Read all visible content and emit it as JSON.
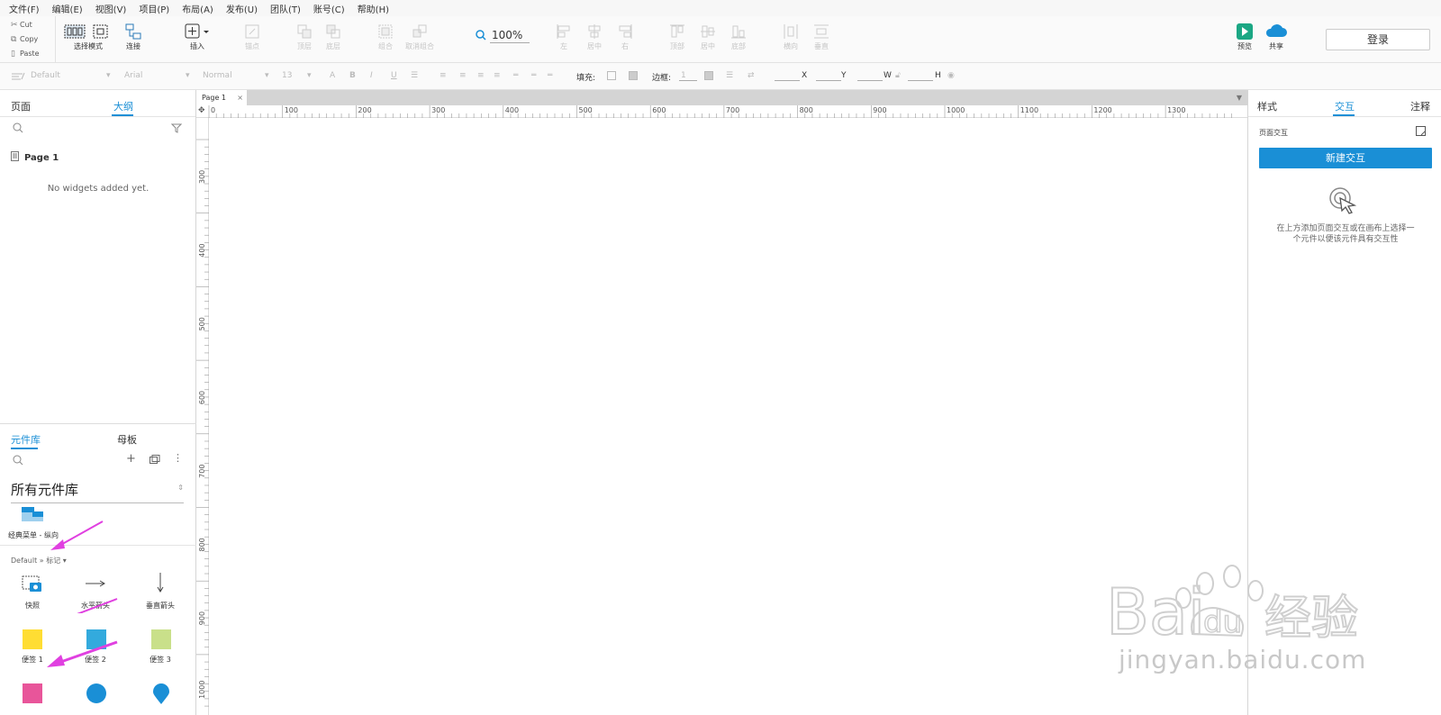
{
  "menu": [
    "文件(F)",
    "编辑(E)",
    "视图(V)",
    "项目(P)",
    "布局(A)",
    "发布(U)",
    "团队(T)",
    "账号(C)",
    "帮助(H)"
  ],
  "clipboard": {
    "cut": "Cut",
    "copy": "Copy",
    "paste": "Paste"
  },
  "toolbar": {
    "select_mode": "选择模式",
    "connect": "连接",
    "insert": "插入",
    "point": "锚点",
    "top": "顶层",
    "bottom": "底层",
    "group": "组合",
    "ungroup": "取消组合",
    "zoom": "100%",
    "left": "左",
    "hcenter": "居中",
    "right": "右",
    "top_align": "顶部",
    "vcenter": "居中",
    "bottom_align": "底部",
    "horizontal": "横向",
    "vertical": "垂直",
    "preview": "预览",
    "share": "共享",
    "login": "登录"
  },
  "stylebar": {
    "style": "Default",
    "font": "Arial",
    "weight": "Normal",
    "size": "13",
    "fill": "填充:",
    "border": "边框:",
    "border_value": "1",
    "x": "X",
    "y": "Y",
    "w": "W",
    "h": "H"
  },
  "left_panel": {
    "tab_pages": "页面",
    "tab_outline": "大纲",
    "page_item": "Page 1",
    "empty": "No widgets added yet.",
    "tab_library": "元件库",
    "tab_masters": "母板",
    "library_select": "所有元件库",
    "menu_widget": "经典菜单 - 纵向",
    "section": "Default » 标记 ▾",
    "widgets": [
      "快照",
      "水平箭头",
      "垂直箭头",
      "便签 1",
      "便签 2",
      "便签 3"
    ]
  },
  "canvas": {
    "tab": "Page 1",
    "hticks": [
      "0",
      "100",
      "200",
      "300",
      "400",
      "500",
      "600",
      "700",
      "800",
      "900",
      "1000",
      "1100",
      "1200",
      "1300"
    ],
    "vticks": [
      "300",
      "400",
      "500",
      "600",
      "700",
      "800",
      "900",
      "1000"
    ]
  },
  "right_panel": {
    "tab_style": "样式",
    "tab_interact": "交互",
    "tab_notes": "注释",
    "page_interact": "页面交互",
    "new_interaction": "新建交互",
    "hint": "在上方添加页面交互或在画布上选择一个元件以便该元件具有交互性"
  },
  "watermark": {
    "url": "jingyan.baidu.com"
  },
  "colors": {
    "accent": "#1a8fd6",
    "preview": "#1ba784",
    "arrow": "#e040e0",
    "sticky1": "#ffdd33",
    "sticky2": "#33aadd",
    "sticky3": "#c9e08a"
  }
}
